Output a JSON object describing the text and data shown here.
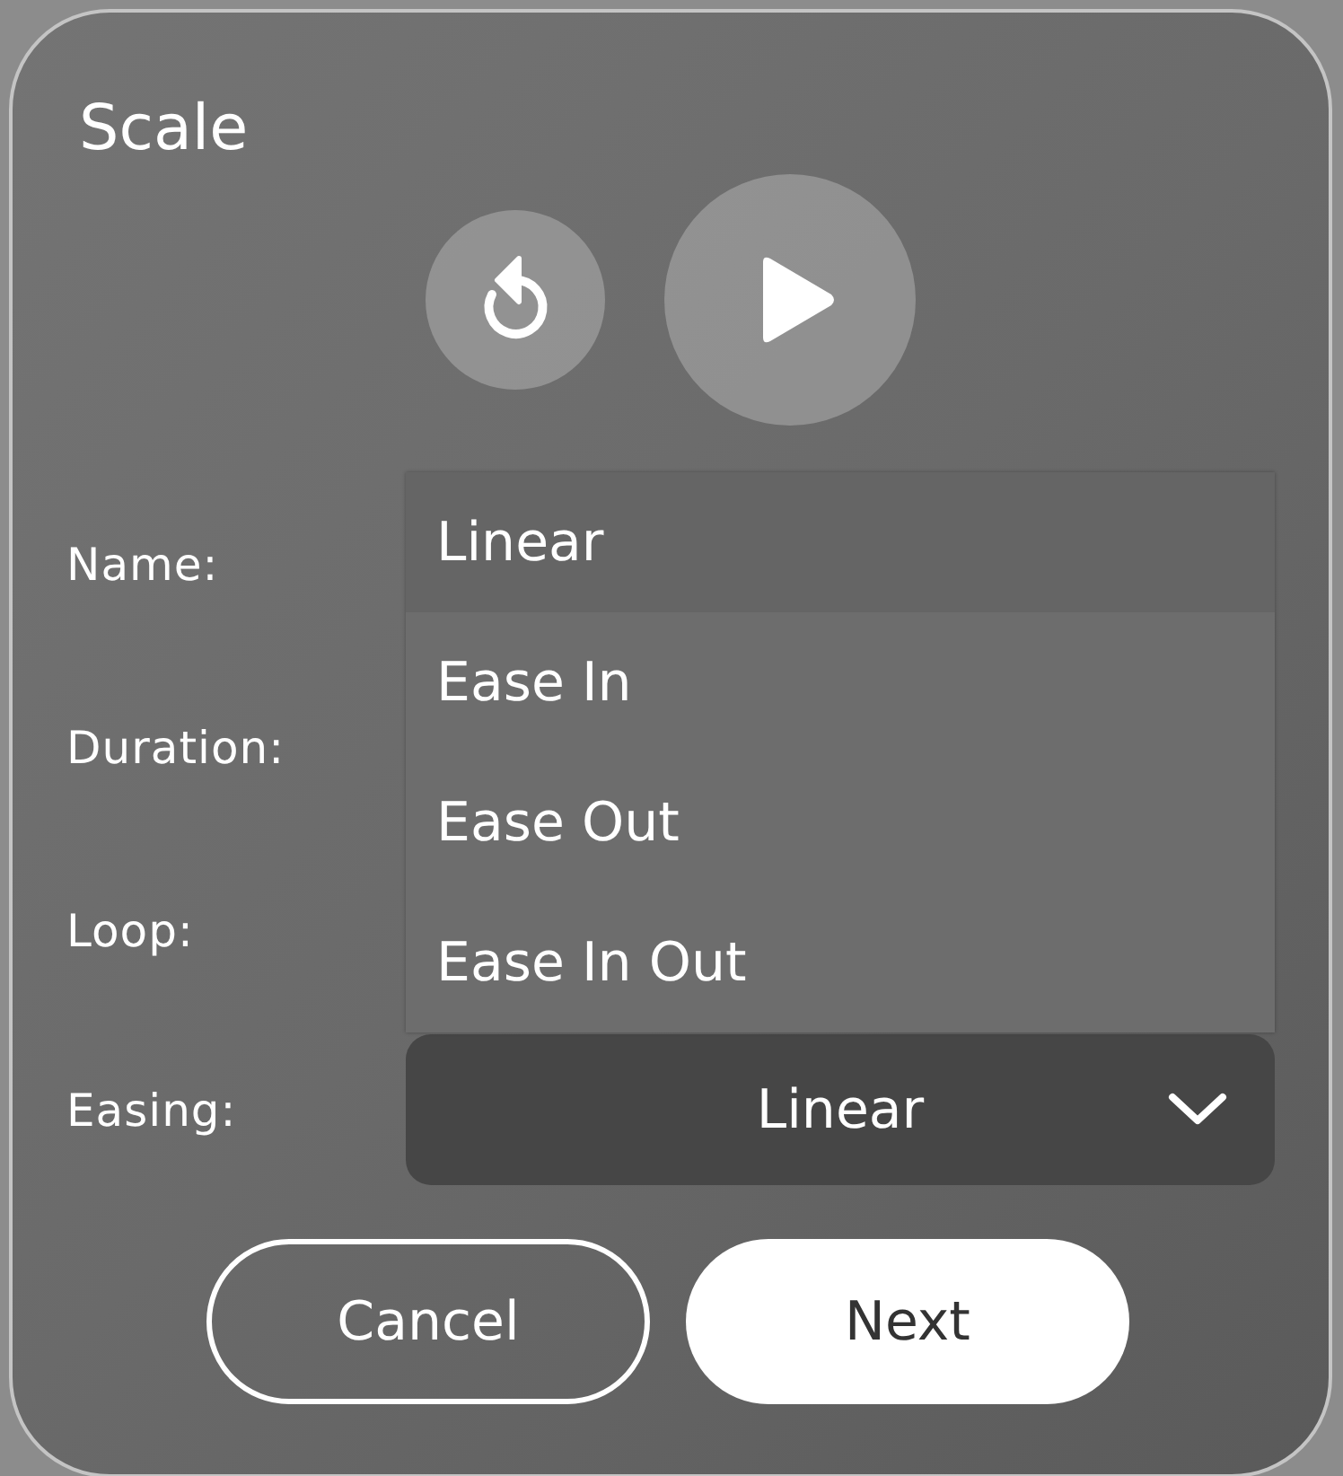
{
  "dialog": {
    "title": "Scale"
  },
  "fields": [
    {
      "label": "Name:"
    },
    {
      "label": "Duration:"
    },
    {
      "label": "Loop:"
    },
    {
      "label": "Easing:",
      "value": "Linear",
      "expanded": true,
      "options": [
        {
          "label": "Linear",
          "selected": true
        },
        {
          "label": "Ease In",
          "selected": false
        },
        {
          "label": "Ease Out",
          "selected": false
        },
        {
          "label": "Ease In Out",
          "selected": false
        }
      ]
    }
  ],
  "buttons": [
    {
      "label": "Cancel",
      "kind": "secondary"
    },
    {
      "label": "Next",
      "kind": "primary"
    }
  ]
}
